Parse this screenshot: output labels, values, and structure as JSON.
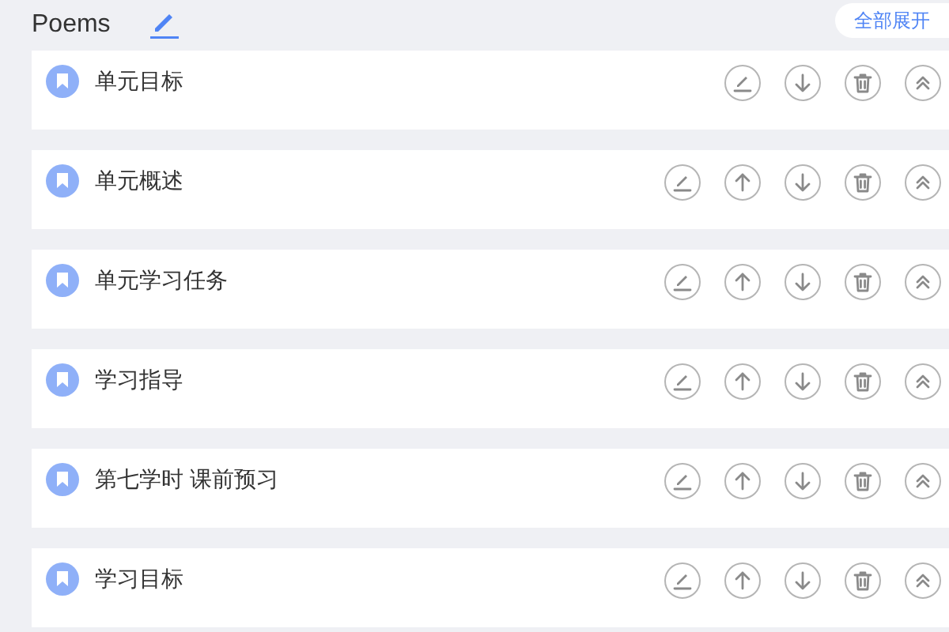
{
  "header": {
    "title": "Poems",
    "expand_all": "全部展开"
  },
  "sections": [
    {
      "title": "单元目标",
      "show_up": false
    },
    {
      "title": "单元概述",
      "show_up": true
    },
    {
      "title": "单元学习任务",
      "show_up": true
    },
    {
      "title": "学习指导",
      "show_up": true
    },
    {
      "title": "第七学时 课前预习",
      "show_up": true
    },
    {
      "title": "学习目标",
      "show_up": true
    }
  ]
}
